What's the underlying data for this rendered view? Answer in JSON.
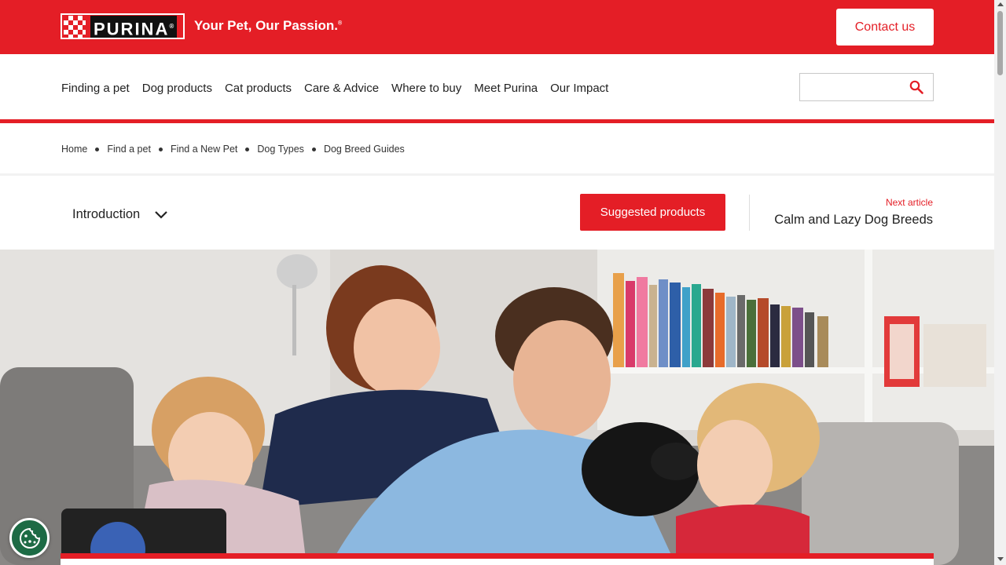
{
  "header": {
    "logo_text": "PURINA",
    "tagline": "Your Pet, Our Passion.",
    "contact_label": "Contact us"
  },
  "nav": {
    "items": [
      "Finding a pet",
      "Dog products",
      "Cat products",
      "Care & Advice",
      "Where to buy",
      "Meet Purina",
      "Our Impact"
    ],
    "search_placeholder": ""
  },
  "breadcrumb": [
    "Home",
    "Find a pet",
    "Find a New Pet",
    "Dog Types",
    "Dog Breed Guides"
  ],
  "article_bar": {
    "toc_label": "Introduction",
    "suggested_label": "Suggested products",
    "next_label": "Next article",
    "next_title": "Calm and Lazy Dog Breeds"
  },
  "colors": {
    "brand_red": "#e41e26",
    "cookie_green": "#1d6b45"
  },
  "icons": {
    "search": "search-icon",
    "chevron": "chevron-down-icon",
    "cookie": "cookie-icon"
  }
}
